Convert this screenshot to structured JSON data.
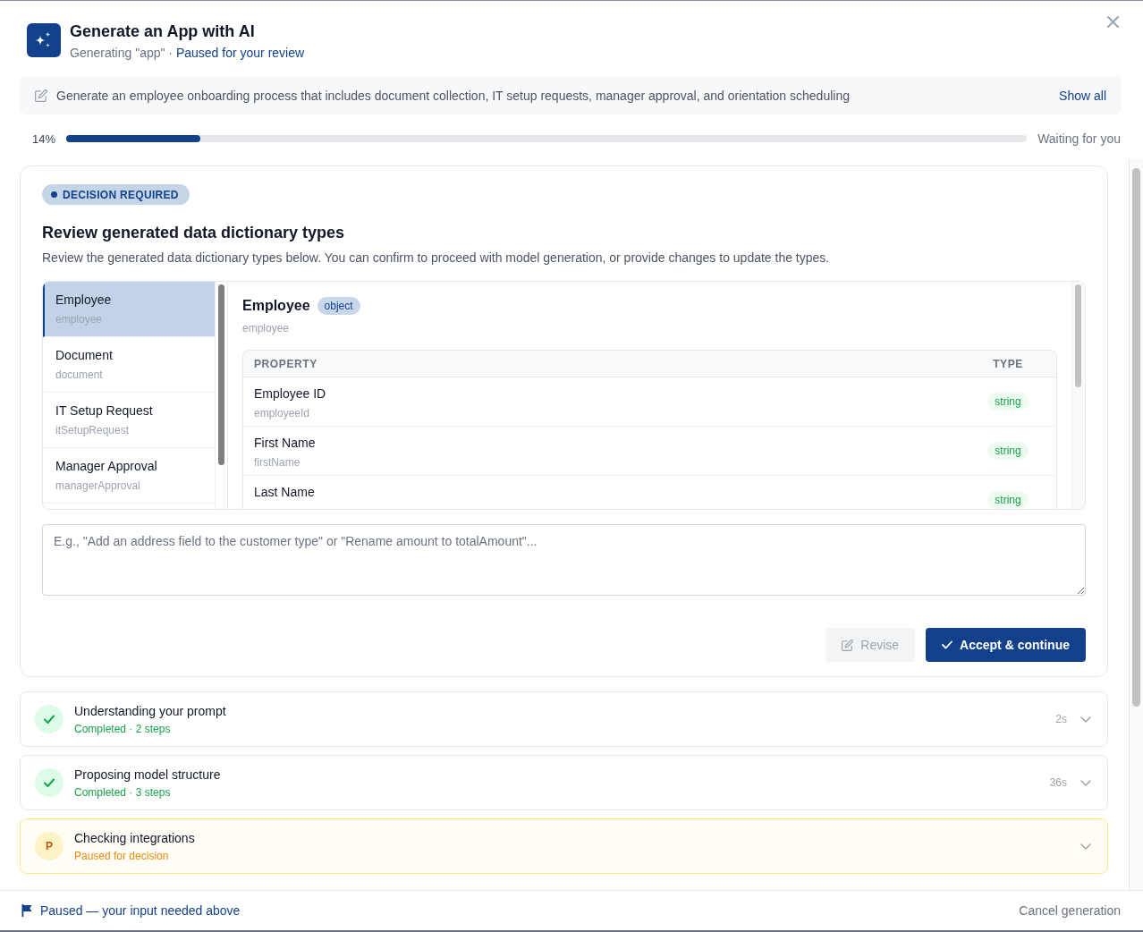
{
  "header": {
    "title": "Generate an App with AI",
    "subtitle": "Generating \"app\" ·",
    "status": "Paused for your review"
  },
  "prompt": {
    "text": "Generate an employee onboarding process that includes document collection, IT setup requests, manager approval, and orientation scheduling",
    "action": "Show all"
  },
  "progress": {
    "percent": "14%",
    "level": 0.14,
    "status": "Waiting for you"
  },
  "decision": {
    "badge": "DECISION REQUIRED",
    "title": "Review generated data dictionary types",
    "description": "Review the generated data dictionary types below. You can confirm to proceed with model generation, or provide changes to update the types.",
    "types": [
      {
        "name": "Employee",
        "key": "employee",
        "selected": true
      },
      {
        "name": "Document",
        "key": "document",
        "selected": false
      },
      {
        "name": "IT Setup Request",
        "key": "itSetupRequest",
        "selected": false
      },
      {
        "name": "Manager Approval",
        "key": "managerApproval",
        "selected": false
      }
    ],
    "detail": {
      "name": "Employee",
      "type": "object",
      "key": "employee",
      "columns": [
        "PROPERTY",
        "TYPE"
      ],
      "rows": [
        {
          "name": "Employee ID",
          "key": "employeeId",
          "type": "string"
        },
        {
          "name": "First Name",
          "key": "firstName",
          "type": "string"
        },
        {
          "name": "Last Name",
          "type": "string"
        }
      ]
    },
    "feedback": {
      "placeholder": "E.g., \"Add an address field to the customer type\" or \"Rename amount to totalAmount\"..."
    },
    "buttons": [
      {
        "label": "Revise",
        "kind": "secondary",
        "disabled": true
      },
      {
        "label": "Accept & continue",
        "kind": "primary",
        "disabled": false
      }
    ]
  },
  "steps": [
    {
      "kind": "completed",
      "title": "Understanding your prompt",
      "status": "Completed · 2 steps",
      "duration": "2s",
      "expanded": false
    },
    {
      "kind": "completed",
      "title": "Proposing model structure",
      "status": "Completed · 3 steps",
      "duration": "36s",
      "expanded": false
    },
    {
      "kind": "paused",
      "initial": "P",
      "title": "Checking integrations",
      "status": "Paused for decision",
      "expanded": false
    }
  ],
  "footer": {
    "status": "Paused — your input needed above",
    "action": "Cancel generation"
  }
}
